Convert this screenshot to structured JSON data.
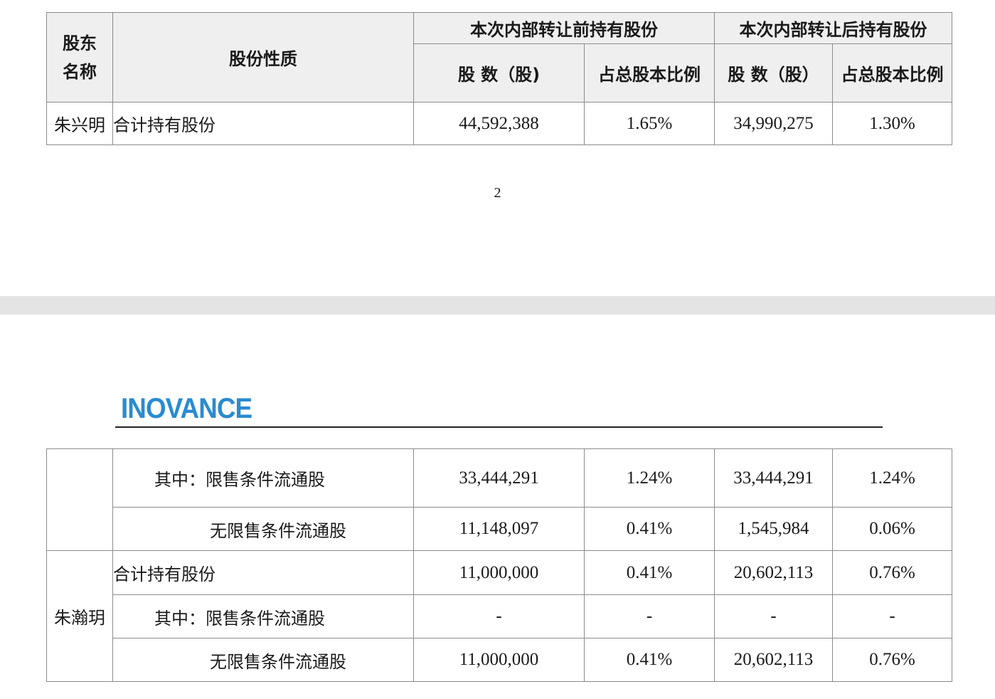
{
  "page_top": {
    "header": {
      "col_shareholder": "股东名称",
      "col_shareholder_line1": "股东",
      "col_shareholder_line2": "名称",
      "col_nature": "股份性质",
      "group_before": "本次内部转让前持有股份",
      "group_after": "本次内部转让后持有股份",
      "col_shares_before": "股 数（股)",
      "col_ratio_before": "占总股本比例",
      "col_shares_after": "股 数（股）",
      "col_ratio_after": "占总股本比例"
    },
    "rows": [
      {
        "name": "朱兴明",
        "nature": "合计持有股份",
        "shares_before": "44,592,388",
        "ratio_before": "1.65%",
        "shares_after": "34,990,275",
        "ratio_after": "1.30%"
      }
    ],
    "page_number": "2"
  },
  "page_bottom": {
    "logo_text": "INOVANCE",
    "rows": [
      {
        "name": "",
        "nature": "其中：限售条件流通股",
        "shares_before": "33,444,291",
        "ratio_before": "1.24%",
        "shares_after": "33,444,291",
        "ratio_after": "1.24%"
      },
      {
        "name": "",
        "nature": "无限售条件流通股",
        "shares_before": "11,148,097",
        "ratio_before": "0.41%",
        "shares_after": "1,545,984",
        "ratio_after": "0.06%"
      },
      {
        "name": "朱瀚玥",
        "nature": "合计持有股份",
        "shares_before": "11,000,000",
        "ratio_before": "0.41%",
        "shares_after": "20,602,113",
        "ratio_after": "0.76%"
      },
      {
        "name": "",
        "nature": "其中：限售条件流通股",
        "shares_before": "-",
        "ratio_before": "-",
        "shares_after": "-",
        "ratio_after": "-"
      },
      {
        "name": "",
        "nature": "无限售条件流通股",
        "shares_before": "11,000,000",
        "ratio_before": "0.41%",
        "shares_after": "20,602,113",
        "ratio_after": "0.76%"
      }
    ]
  }
}
